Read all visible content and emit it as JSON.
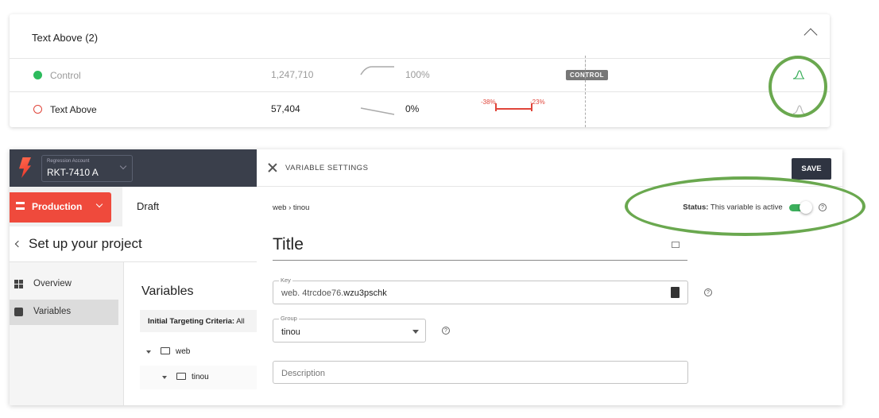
{
  "experiment_table": {
    "section_title": "Text Above (2)",
    "rows": [
      {
        "name": "Control",
        "count": "1,247,710",
        "percent": "100%",
        "badge": "CONTROL",
        "dot_color": "#2dbb5d"
      },
      {
        "name": "Text Above",
        "count": "57,404",
        "percent": "0%",
        "ci_low": "-38%",
        "ci_high": "-23%",
        "dot_color": "#e0453a"
      }
    ]
  },
  "account": {
    "label": "Regression Account",
    "name": "RKT-7410 A"
  },
  "environment": {
    "selected": "Production",
    "accent": "#ef4a3c"
  },
  "draft_tab": "Draft",
  "project_header": "Set up your project",
  "side_menu": {
    "items": [
      {
        "label": "Overview",
        "icon": "grid-icon"
      },
      {
        "label": "Variables",
        "icon": "variable-icon",
        "active": true
      }
    ]
  },
  "variables_pane": {
    "title": "Variables",
    "criteria_label": "Initial Targeting Criteria:",
    "criteria_value": "All",
    "tree": [
      {
        "label": "web",
        "icon": "folder-icon"
      },
      {
        "label": "tinou",
        "icon": "folder-icon"
      }
    ]
  },
  "settings": {
    "header_title": "VARIABLE SETTINGS",
    "save_label": "SAVE",
    "breadcrumb": "web › tinou",
    "status_label": "Status:",
    "status_text": "This variable is active",
    "toggle_on": true,
    "title_value": "Title",
    "key_label": "Key",
    "key_prefix": "web. 4trcdoe76.",
    "key_suffix": "wzu3pschk",
    "group_label": "Group",
    "group_value": "tinou",
    "description_placeholder": "Description",
    "help_glyph": "?",
    "highlight_color": "#6aa84f"
  }
}
